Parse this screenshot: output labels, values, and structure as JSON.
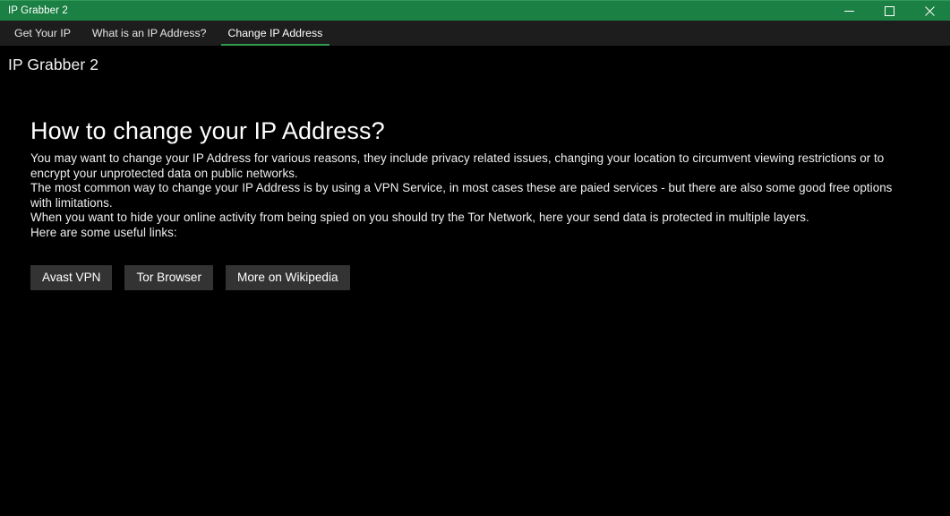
{
  "window": {
    "title": "IP Grabber 2",
    "titlebar_color": "#1b8043",
    "controls": [
      {
        "name": "minimize",
        "glyph": "minimize-icon"
      },
      {
        "name": "maximize",
        "glyph": "maximize-icon"
      },
      {
        "name": "close",
        "glyph": "close-icon"
      }
    ]
  },
  "nav": {
    "items": [
      {
        "label": "Get Your IP",
        "active": false
      },
      {
        "label": "What is an IP Address?",
        "active": false
      },
      {
        "label": "Change IP Address",
        "active": true
      }
    ],
    "active_underline_color": "#2e9b4f"
  },
  "app": {
    "header": "IP Grabber 2"
  },
  "main": {
    "heading": "How to change your IP Address?",
    "paragraphs": [
      "You may want to change your IP Address for various reasons, they include privacy related issues, changing your location to circumvent viewing restrictions or to encrypt your unprotected data on public networks.",
      "The most common way to change your IP Address is by using a VPN Service, in most cases these are paied services - but there are also some good free options with limitations.",
      "When you want to hide your online activity from being spied on you should try the Tor Network, here your send data is protected in multiple layers.",
      "Here are some useful links:"
    ],
    "buttons": [
      {
        "label": "Avast VPN",
        "name": "avast-vpn-button"
      },
      {
        "label": "Tor Browser",
        "name": "tor-browser-button"
      },
      {
        "label": "More on Wikipedia",
        "name": "more-on-wikipedia-button"
      }
    ]
  }
}
